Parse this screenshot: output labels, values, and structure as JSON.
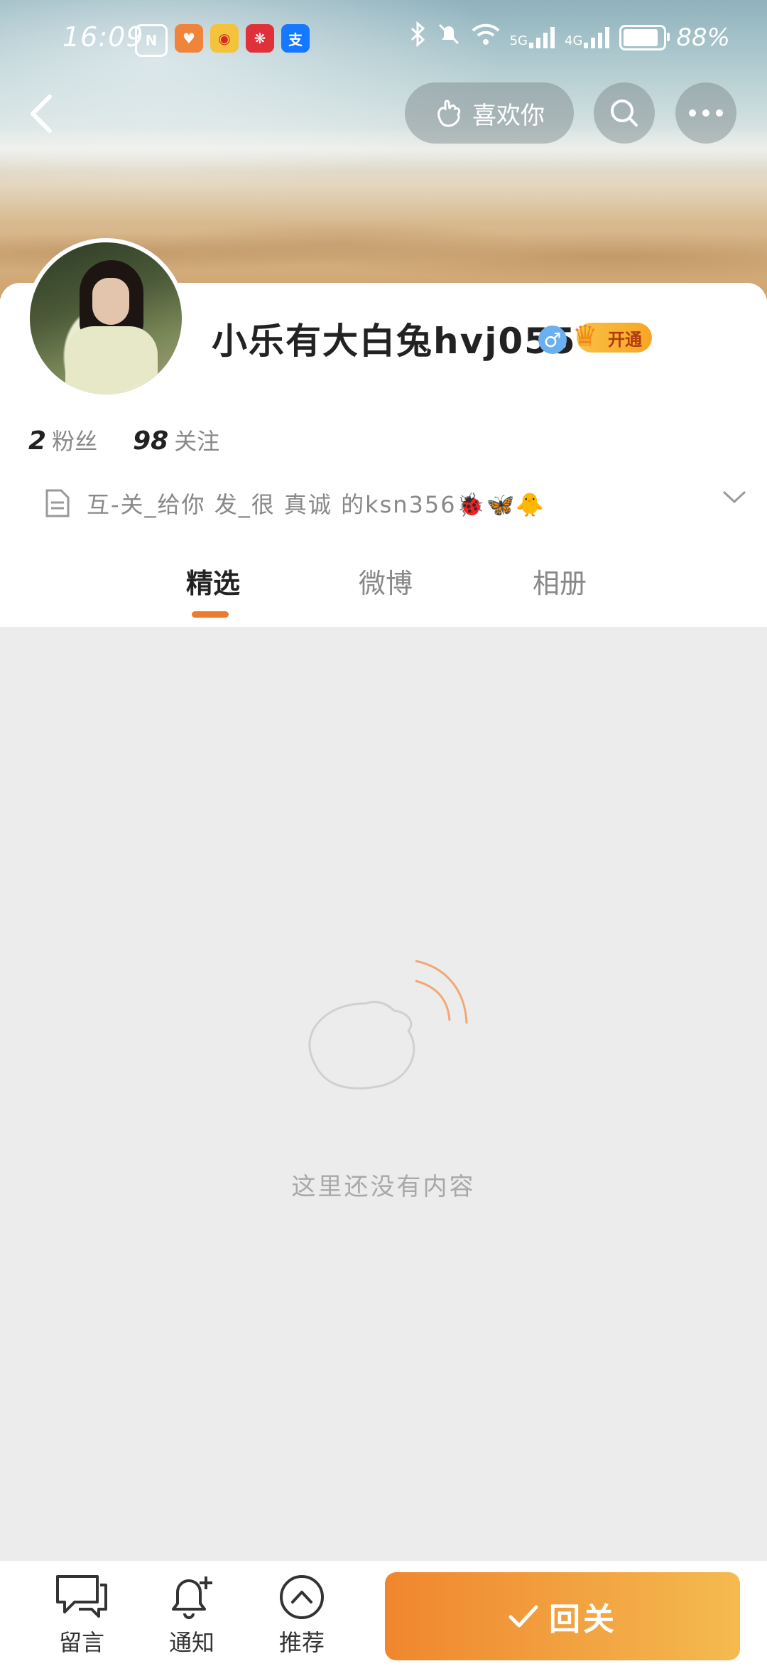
{
  "status_bar": {
    "time": "16:09",
    "battery": "88%",
    "network_5g": "5G",
    "network_4g": "4G",
    "battery_level": 0.88
  },
  "nav": {
    "like_label": "喜欢你"
  },
  "profile": {
    "username": "小乐有大白兔hvj055",
    "gender_symbol": "♂",
    "vip_label": "开通",
    "followers_count": "2",
    "followers_label": "粉丝",
    "following_count": "98",
    "following_label": "关注",
    "bio": "互-关_给你 发_很 真诚 的ksn356🐞🦋🐥"
  },
  "tabs": [
    {
      "label": "精选",
      "active": true
    },
    {
      "label": "微博",
      "active": false
    },
    {
      "label": "相册",
      "active": false
    }
  ],
  "empty_state": {
    "message": "这里还没有内容"
  },
  "bottom_bar": {
    "message_label": "留言",
    "notify_label": "通知",
    "recommend_label": "推荐",
    "follow_back_label": "回关"
  },
  "colors": {
    "accent": "#f07a2c",
    "gender": "#6ab0f0",
    "vip": "#f6a623"
  }
}
